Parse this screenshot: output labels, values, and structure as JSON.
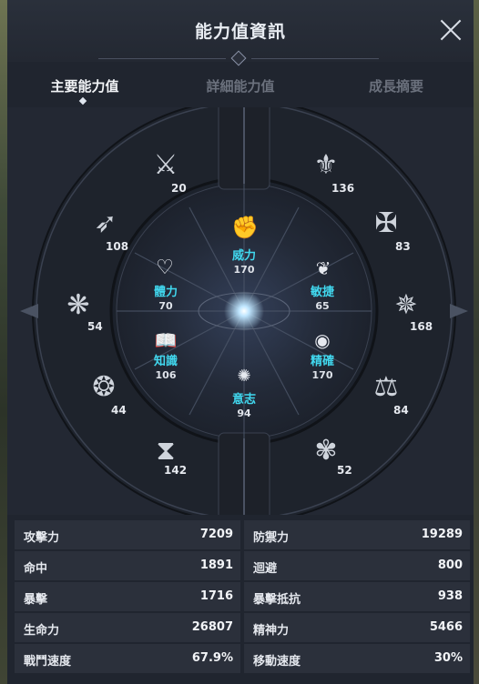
{
  "window": {
    "title": "能力值資訊"
  },
  "tabs": [
    {
      "label": "主要能力值",
      "active": true
    },
    {
      "label": "詳細能力值",
      "active": false
    },
    {
      "label": "成長摘要",
      "active": false
    }
  ],
  "core_stats": {
    "power": {
      "label": "威力",
      "value": "170"
    },
    "health": {
      "label": "體力",
      "value": "70"
    },
    "agility": {
      "label": "敏捷",
      "value": "65"
    },
    "knowledge": {
      "label": "知識",
      "value": "106"
    },
    "precision": {
      "label": "精確",
      "value": "170"
    },
    "will": {
      "label": "意志",
      "value": "94"
    }
  },
  "outer_skills": [
    {
      "icon": "sword-crest-icon",
      "value": "20"
    },
    {
      "icon": "winged-sword-icon",
      "value": "136"
    },
    {
      "icon": "arrow-swirl-icon",
      "value": "108"
    },
    {
      "icon": "crossed-spears-icon",
      "value": "83"
    },
    {
      "icon": "butterfly-icon",
      "value": "54"
    },
    {
      "icon": "star-compass-icon",
      "value": "168"
    },
    {
      "icon": "tree-emblem-icon",
      "value": "44"
    },
    {
      "icon": "scales-icon",
      "value": "84"
    },
    {
      "icon": "hourglass-icon",
      "value": "142"
    },
    {
      "icon": "spiral-flower-icon",
      "value": "52"
    }
  ],
  "stats_table": [
    {
      "left_label": "攻擊力",
      "left_value": "7209",
      "right_label": "防禦力",
      "right_value": "19289"
    },
    {
      "left_label": "命中",
      "left_value": "1891",
      "right_label": "迴避",
      "right_value": "800"
    },
    {
      "left_label": "暴擊",
      "left_value": "1716",
      "right_label": "暴擊抵抗",
      "right_value": "938"
    },
    {
      "left_label": "生命力",
      "left_value": "26807",
      "right_label": "精神力",
      "right_value": "5466"
    },
    {
      "left_label": "戰鬥速度",
      "left_value": "67.9%",
      "right_label": "移動速度",
      "right_value": "30%"
    }
  ],
  "colors": {
    "accent_cyan": "#41d8ef",
    "panel_bg": "#20252f",
    "row_bg": "#2b303b"
  }
}
